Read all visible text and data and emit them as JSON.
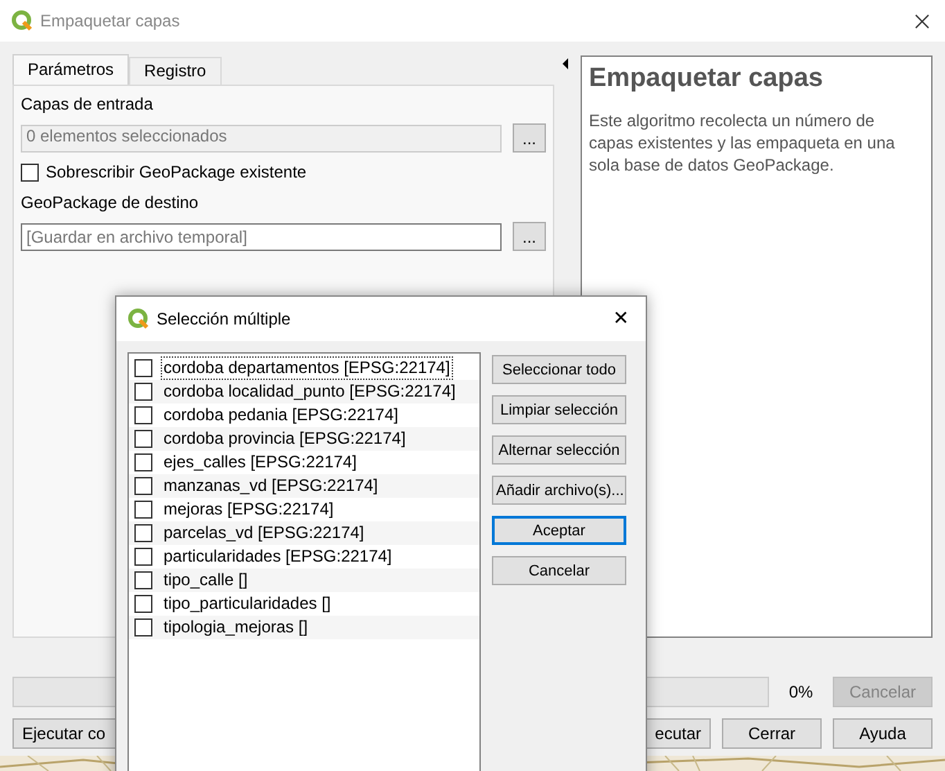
{
  "window": {
    "title": "Empaquetar capas"
  },
  "tabs": [
    {
      "label": "Parámetros",
      "selected": true
    },
    {
      "label": "Registro",
      "selected": false
    }
  ],
  "parameters": {
    "input_label": "Capas de entrada",
    "input_value": "0 elementos seleccionados",
    "overwrite": {
      "label": "Sobrescribir GeoPackage existente",
      "checked": false
    },
    "dest_label": "GeoPackage de destino",
    "dest_placeholder": "[Guardar en archivo temporal]",
    "browse": "..."
  },
  "help": {
    "title": "Empaquetar capas",
    "text": "Este algoritmo recolecta un número de capas existentes y las empaqueta en una sola base de datos GeoPackage."
  },
  "progress": {
    "level": 0,
    "reading": "0%",
    "cancel": "Cancelar"
  },
  "buttons": [
    {
      "label": "Ejecutar co"
    },
    {
      "label": "ecutar"
    },
    {
      "label": "Cerrar"
    },
    {
      "label": "Ayuda"
    }
  ],
  "dialog": {
    "title": "Selección múltiple",
    "close": "✕",
    "items": [
      {
        "label": "cordoba departamentos [EPSG:22174]",
        "checked": false
      },
      {
        "label": "cordoba localidad_punto [EPSG:22174]",
        "checked": false
      },
      {
        "label": "cordoba pedania [EPSG:22174]",
        "checked": false
      },
      {
        "label": "cordoba provincia [EPSG:22174]",
        "checked": false
      },
      {
        "label": "ejes_calles [EPSG:22174]",
        "checked": false
      },
      {
        "label": "manzanas_vd [EPSG:22174]",
        "checked": false
      },
      {
        "label": "mejoras [EPSG:22174]",
        "checked": false
      },
      {
        "label": "parcelas_vd [EPSG:22174]",
        "checked": false
      },
      {
        "label": "particularidades [EPSG:22174]",
        "checked": false
      },
      {
        "label": "tipo_calle []",
        "checked": false
      },
      {
        "label": "tipo_particularidades []",
        "checked": false
      },
      {
        "label": "tipologia_mejoras []",
        "checked": false
      }
    ],
    "buttons": [
      {
        "label": "Seleccionar todo",
        "default": false
      },
      {
        "label": "Limpiar selección",
        "default": false
      },
      {
        "label": "Alternar selección",
        "default": false
      },
      {
        "label": "Añadir archivo(s)...",
        "default": false
      },
      {
        "label": "Aceptar",
        "default": true
      },
      {
        "label": "Cancelar",
        "default": false
      }
    ]
  }
}
